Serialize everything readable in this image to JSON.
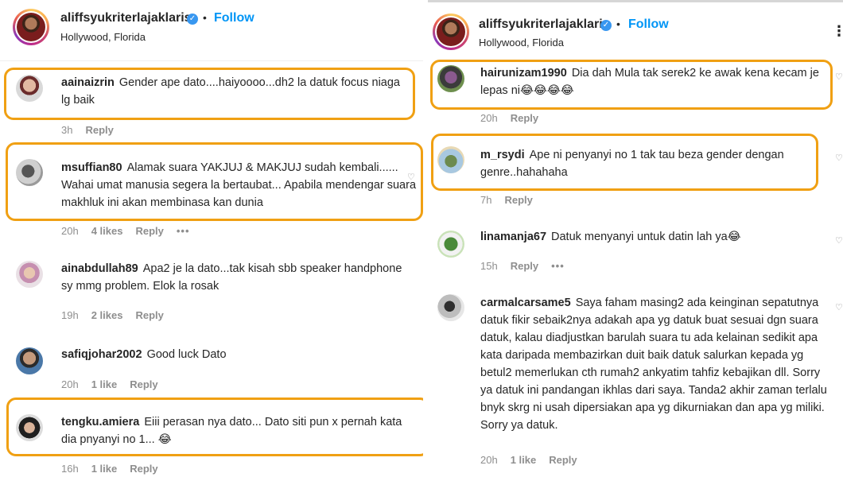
{
  "post": {
    "username": "aliffsyukriterlajaklaris",
    "follow_label": "Follow",
    "location": "Hollywood, Florida",
    "separator": "•"
  },
  "left_comments": [
    {
      "user": "aainaizrin",
      "text": "Gender ape dato....haiyoooo...dh2 la datuk focus niaga lg baik",
      "time": "3h",
      "likes": "",
      "reply": "Reply"
    },
    {
      "user": "msuffian80",
      "text": "Alamak suara YAKJUJ & MAKJUJ sudah kembali...... Wahai umat manusia segera la bertaubat... Apabila mendengar suara makhluk ini akan membinasa kan dunia",
      "time": "20h",
      "likes": "4 likes",
      "reply": "Reply",
      "more": "•••"
    },
    {
      "user": "ainabdullah89",
      "text": "Apa2 je la dato...tak kisah sbb speaker handphone sy mmg problem. Elok la rosak",
      "time": "19h",
      "likes": "2 likes",
      "reply": "Reply"
    },
    {
      "user": "safiqjohar2002",
      "text": "Good luck Dato",
      "time": "20h",
      "likes": "1 like",
      "reply": "Reply"
    },
    {
      "user": "tengku.amiera",
      "text": "Eiii perasan nya dato... Dato siti pun x pernah kata dia pnyanyi no 1... 😂",
      "time": "16h",
      "likes": "1 like",
      "reply": "Reply"
    }
  ],
  "right_comments": [
    {
      "user": "hairunizam1990",
      "text": "Dia dah Mula tak serek2 ke awak kena kecam je lepas ni😂😂😂😂",
      "time": "20h",
      "likes": "",
      "reply": "Reply"
    },
    {
      "user": "m_rsydi",
      "text": "Ape ni penyanyi no 1 tak tau beza gender dengan genre..hahahaha",
      "time": "7h",
      "likes": "",
      "reply": "Reply"
    },
    {
      "user": "linamanja67",
      "text": "Datuk menyanyi untuk datin lah ya😂",
      "time": "15h",
      "likes": "",
      "reply": "Reply",
      "more": "•••"
    },
    {
      "user": "carmalcarsame5",
      "text": "Saya faham masing2 ada keinginan sepatutnya datuk fikir sebaik2nya adakah apa yg datuk buat sesuai dgn suara datuk, kalau diadjustkan barulah suara tu ada kelainan sedikit apa kata daripada membazirkan duit baik datuk salurkan kepada yg betul2 memerlukan cth rumah2 ankyatim tahfiz kebajikan dll. Sorry ya datuk ini pandangan ikhlas dari saya. Tanda2 akhir zaman terlalu bnyk skrg ni usah dipersiakan apa yg dikurniakan dan apa yg miliki. Sorry ya datuk.",
      "time": "20h",
      "likes": "1 like",
      "reply": "Reply"
    }
  ],
  "colors": {
    "highlight": "#f0a013",
    "follow": "#0095f6",
    "verified": "#3897f0",
    "meta": "#8e8e8e"
  },
  "icons": [
    "verified-badge-icon",
    "heart-icon",
    "more-options-icon"
  ]
}
